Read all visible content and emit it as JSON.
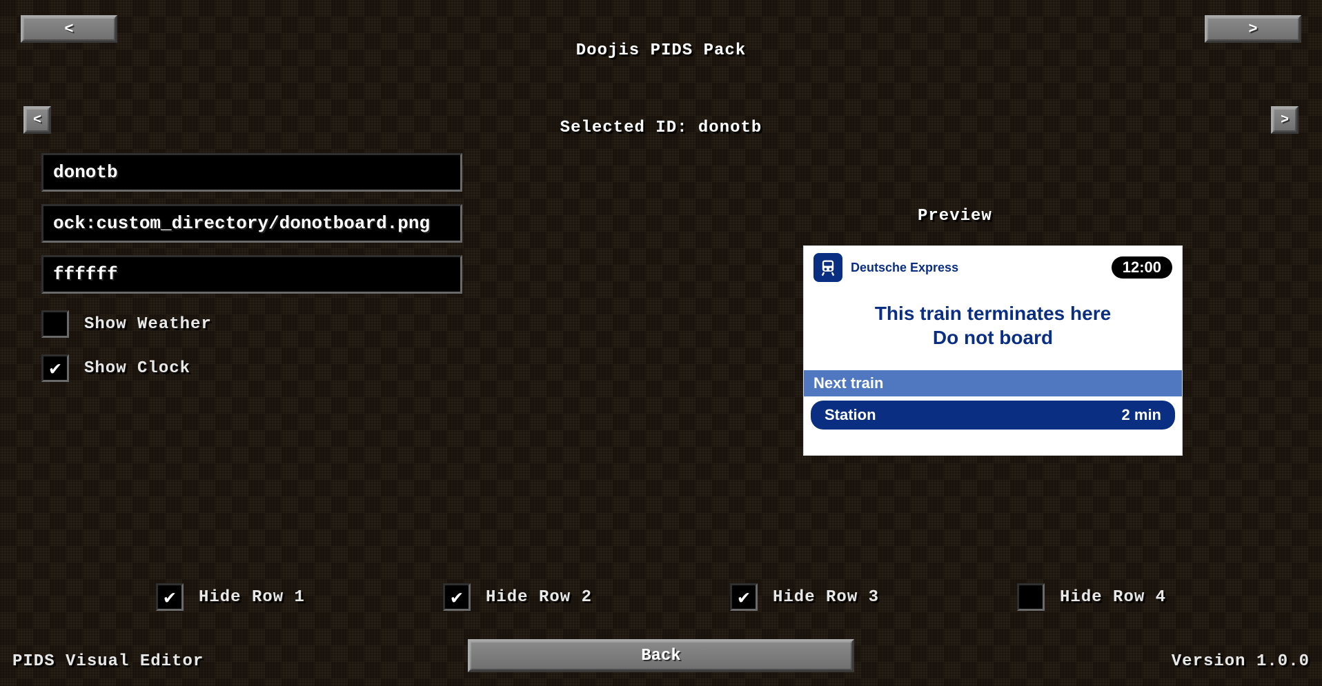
{
  "title": "Doojis PIDS Pack",
  "selected_id_prefix": "Selected ID: ",
  "selected_id": "donotb",
  "nav": {
    "prev": "<",
    "next": ">",
    "prev_sm": "<",
    "next_sm": ">"
  },
  "form": {
    "id_value": "donotb",
    "path_value": "ock:custom_directory/donotboard.png",
    "color_value": "ffffff",
    "show_weather_label": "Show Weather",
    "show_weather_checked": false,
    "show_clock_label": "Show Clock",
    "show_clock_checked": true
  },
  "preview": {
    "label": "Preview",
    "brand": "Deutsche Express",
    "clock": "12:00",
    "message_line1": "This train terminates here",
    "message_line2": "Do not board",
    "next_train_label": "Next train",
    "station_label": "Station",
    "eta": "2 min"
  },
  "rowChecks": {
    "r1": {
      "label": "Hide Row 1",
      "checked": true
    },
    "r2": {
      "label": "Hide Row 2",
      "checked": true
    },
    "r3": {
      "label": "Hide Row 3",
      "checked": true
    },
    "r4": {
      "label": "Hide Row 4",
      "checked": false
    }
  },
  "footer": {
    "back": "Back",
    "app_name": "PIDS Visual Editor",
    "version": "Version 1.0.0"
  },
  "icons": {
    "train": "train-icon"
  },
  "colors": {
    "accent_blue": "#0a2f82",
    "row_blue": "#5078c0"
  }
}
